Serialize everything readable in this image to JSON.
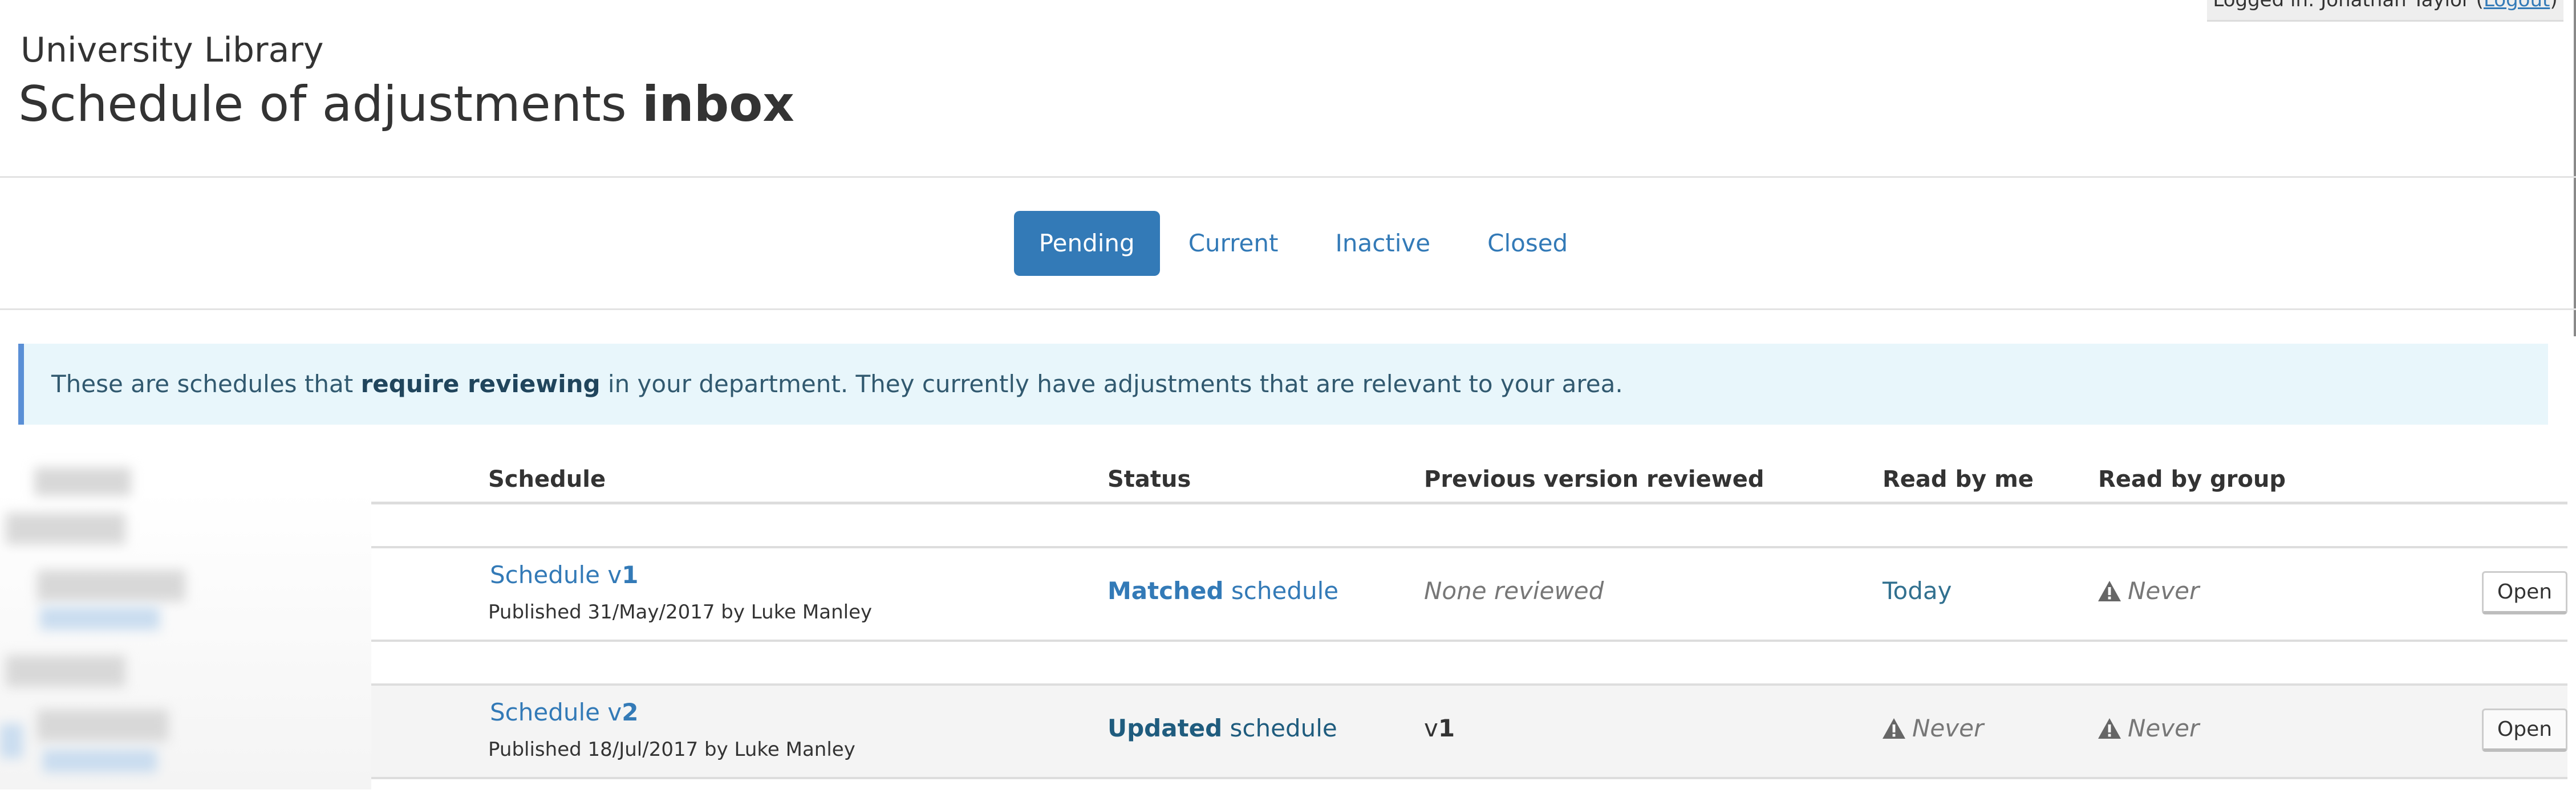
{
  "session": {
    "logged_in_prefix": "Logged in: Jonathan Taylor (",
    "logout_label": "Logout",
    "logged_in_suffix": ")"
  },
  "header": {
    "org_name": "University Library",
    "title_main": "Schedule of adjustments ",
    "title_bold": "inbox"
  },
  "tabs": [
    {
      "label": "Pending",
      "active": true
    },
    {
      "label": "Current",
      "active": false
    },
    {
      "label": "Inactive",
      "active": false
    },
    {
      "label": "Closed",
      "active": false
    }
  ],
  "alert": {
    "text_before": "These are schedules that ",
    "text_bold": "require reviewing",
    "text_after": " in your department. They currently have adjustments that are relevant to your area."
  },
  "table": {
    "columns": [
      "Schedule",
      "Status",
      "Previous version reviewed",
      "Read by me",
      "Read by group"
    ],
    "rows": [
      {
        "schedule_prefix": "Schedule v",
        "schedule_version": "1",
        "published": "Published 31/May/2017 by Luke Manley",
        "status_bold": "Matched",
        "status_rest": " schedule",
        "previous_version": "None reviewed",
        "read_by_me": "Today",
        "read_by_group": "Never",
        "action_label": "Open"
      },
      {
        "schedule_prefix": "Schedule v",
        "schedule_version": "2",
        "published": "Published 18/Jul/2017 by Luke Manley",
        "status_bold": "Updated",
        "status_rest": " schedule",
        "previous_version_prefix": "v",
        "previous_version_bold": "1",
        "read_by_me": "Never",
        "read_by_group": "Never",
        "action_label": "Open"
      }
    ]
  },
  "icons": {
    "warning": "warning-triangle-icon"
  },
  "colors": {
    "accent": "#337ab7",
    "alert_bg": "#e8f6fb",
    "alert_border": "#5a8fd6",
    "updated_status": "#1f5c7e",
    "today": "#31708f",
    "muted": "#777777"
  }
}
